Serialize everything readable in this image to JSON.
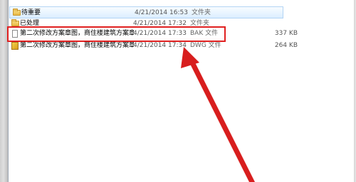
{
  "files": [
    {
      "name": "待重要",
      "date": "4/21/2014 16:53",
      "type": "文件夹",
      "size": "",
      "icon": "folder-icon"
    },
    {
      "name": "已处理",
      "date": "4/21/2014 17:32",
      "type": "文件夹",
      "size": "",
      "icon": "folder-icon"
    },
    {
      "name": "第二次修改方案章图，商住楼建筑方案章",
      "date": "4/21/2014 17:33",
      "type": "BAK 文件",
      "size": "337 KB",
      "icon": "file-icon"
    },
    {
      "name": "第二次修改方案章图，商住楼建筑方案章",
      "date": "4/21/2014 17:34",
      "type": "DWG 文件",
      "size": "264 KB",
      "icon": "dwg-file-icon"
    }
  ],
  "annotation": {
    "box_color": "#e02020",
    "arrow_color": "#d81e1e"
  }
}
